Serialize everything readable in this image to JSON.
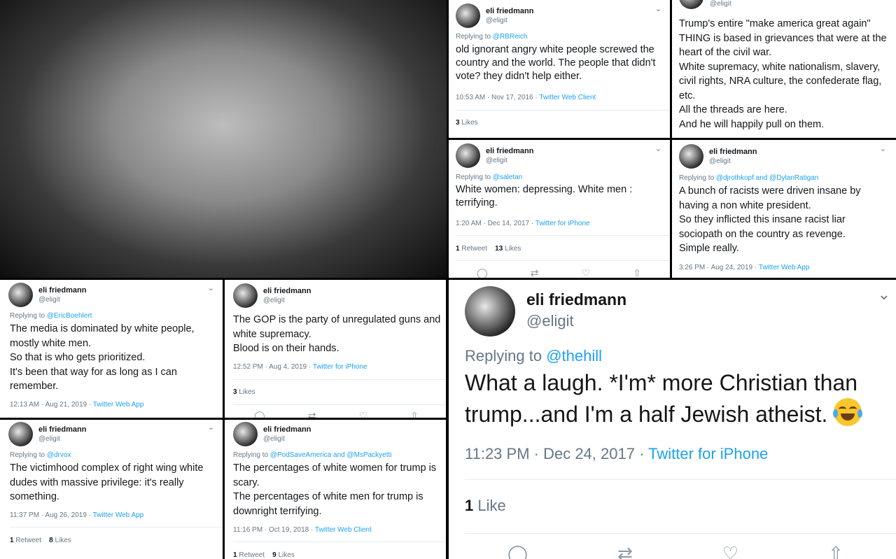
{
  "user": {
    "display_name": "eli friedmann",
    "handle": "@eligit"
  },
  "tweets": {
    "t1": {
      "replying_prefix": "Replying to ",
      "replying_to": "@RBReich",
      "text": "old ignorant angry white people screwed the country and the world. The people that didn't vote? they didn't help either.",
      "time": "10:53 AM · Nov 17, 2016 · ",
      "client": "Twitter Web Client",
      "likes_num": "3",
      "likes_label": " Likes"
    },
    "t2": {
      "handle_partial": "@eligit",
      "text": "Trump's entire \"make america great again\" THING is based in grievances that were at the heart of the civil war.\nWhite supremacy, white nationalism, slavery, civil rights, NRA culture, the confederate flag, etc.\nAll the threads are here.\nAnd he will happily pull on them."
    },
    "t3": {
      "replying_prefix": "Replying to ",
      "replying_to": "@saletan",
      "text": "White women: depressing. White men : terrifying.",
      "time": "1:20 AM · Dec 14, 2017 · ",
      "client": "Twitter for iPhone",
      "retweets_num": "1",
      "retweets_label": " Retweet",
      "likes_num": "13",
      "likes_label": " Likes"
    },
    "t4": {
      "replying_prefix": "Replying to ",
      "replying_to": "@djrothkopf and @DylanRatigan",
      "text": "A bunch of racists were driven insane by having a non white president.\nSo they inflicted this insane racist liar sociopath on the country as revenge.\nSimple really.",
      "time": "3:26 PM · Aug 24, 2019 · ",
      "client": "Twitter Web App"
    },
    "t5": {
      "replying_prefix": "Replying to ",
      "replying_to": "@EricBoehlert",
      "text": "The media is dominated by white people, mostly white men.\nSo that is who gets prioritized.\nIt's been that way for as long as I can remember.",
      "time": "12:13 AM · Aug 21, 2019 · ",
      "client": "Twitter Web App"
    },
    "t6": {
      "text": "The GOP is the party of unregulated guns and white supremacy.\nBlood is on their hands.",
      "time": "12:52 PM · Aug 4, 2019 · ",
      "client": "Twitter for iPhone",
      "likes_num": "3",
      "likes_label": " Likes"
    },
    "t7": {
      "replying_prefix": "Replying to ",
      "replying_to": "@drvox",
      "text": "The victimhood complex of right wing white dudes with massive privilege: it's really something.",
      "time": "11:37 PM · Aug 26, 2019 · ",
      "client": "Twitter Web App",
      "retweets_num": "1",
      "retweets_label": " Retweet",
      "likes_num": "8",
      "likes_label": " Likes"
    },
    "t8": {
      "replying_prefix": "Replying to ",
      "replying_to": "@PodSaveAmerica and @MsPackyetti",
      "text": "The percentages of white women for trump is scary.\nThe percentages of white men for trump is downright terrifying.",
      "time": "11:16 PM · Oct 19, 2018 · ",
      "client": "Twitter Web Client",
      "retweets_num": "1",
      "retweets_label": " Retweet",
      "likes_num": "9",
      "likes_label": " Likes"
    },
    "t9": {
      "replying_prefix": "Replying to ",
      "replying_to": "@thehill",
      "text": "What a laugh. *I'm* more Christian than trump...and I'm a half Jewish atheist.",
      "emoji": "face-with-tears-of-joy",
      "time": "11:23 PM · Dec 24, 2017 · ",
      "client": "Twitter for iPhone",
      "likes_num": "1",
      "likes_label": " Like"
    }
  },
  "icons": {
    "chevron": "chevron-down-icon",
    "reply": "reply-icon",
    "retweet": "retweet-icon",
    "like": "heart-icon",
    "share": "share-icon"
  },
  "colors": {
    "link": "#1da1f2",
    "muted": "#657786",
    "text": "#14171a"
  }
}
